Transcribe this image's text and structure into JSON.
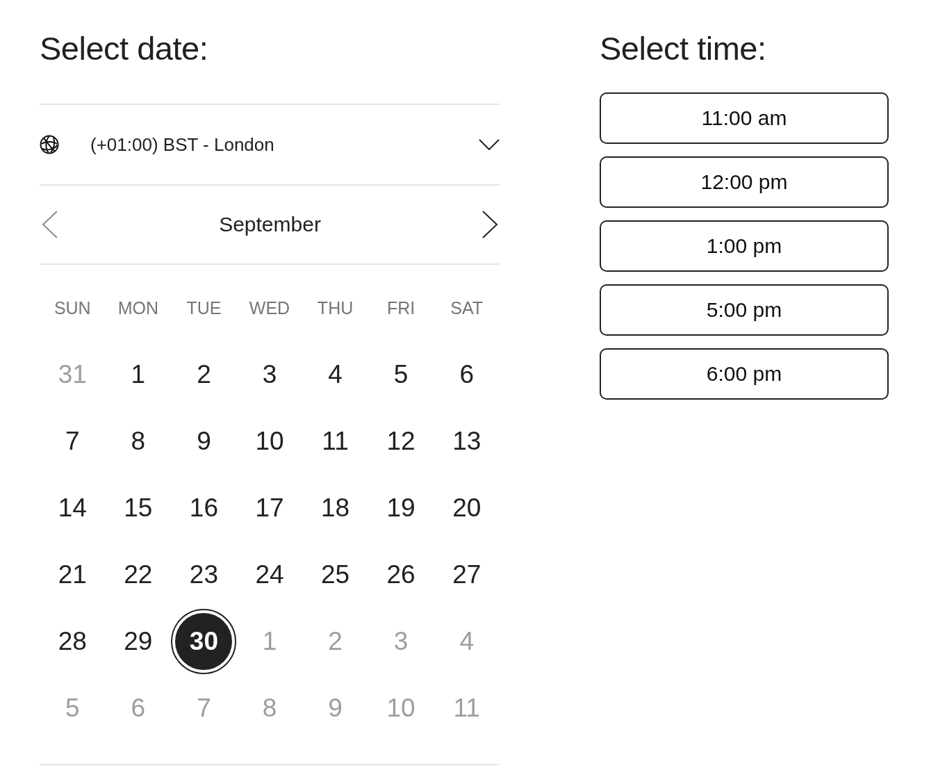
{
  "date_panel": {
    "title": "Select date:",
    "timezone": {
      "label": "(+01:00) BST - London"
    },
    "month_nav": {
      "month": "September",
      "prev": {
        "disabled": true
      },
      "next": {
        "disabled": false
      }
    },
    "weekdays": [
      "SUN",
      "MON",
      "TUE",
      "WED",
      "THU",
      "FRI",
      "SAT"
    ],
    "weeks": [
      {
        "days": [
          {
            "label": "31",
            "other_month": true,
            "selected": false
          },
          {
            "label": "1",
            "other_month": false,
            "selected": false
          },
          {
            "label": "2",
            "other_month": false,
            "selected": false
          },
          {
            "label": "3",
            "other_month": false,
            "selected": false
          },
          {
            "label": "4",
            "other_month": false,
            "selected": false
          },
          {
            "label": "5",
            "other_month": false,
            "selected": false
          },
          {
            "label": "6",
            "other_month": false,
            "selected": false
          }
        ]
      },
      {
        "days": [
          {
            "label": "7",
            "other_month": false,
            "selected": false
          },
          {
            "label": "8",
            "other_month": false,
            "selected": false
          },
          {
            "label": "9",
            "other_month": false,
            "selected": false
          },
          {
            "label": "10",
            "other_month": false,
            "selected": false
          },
          {
            "label": "11",
            "other_month": false,
            "selected": false
          },
          {
            "label": "12",
            "other_month": false,
            "selected": false
          },
          {
            "label": "13",
            "other_month": false,
            "selected": false
          }
        ]
      },
      {
        "days": [
          {
            "label": "14",
            "other_month": false,
            "selected": false
          },
          {
            "label": "15",
            "other_month": false,
            "selected": false
          },
          {
            "label": "16",
            "other_month": false,
            "selected": false
          },
          {
            "label": "17",
            "other_month": false,
            "selected": false
          },
          {
            "label": "18",
            "other_month": false,
            "selected": false
          },
          {
            "label": "19",
            "other_month": false,
            "selected": false
          },
          {
            "label": "20",
            "other_month": false,
            "selected": false
          }
        ]
      },
      {
        "days": [
          {
            "label": "21",
            "other_month": false,
            "selected": false
          },
          {
            "label": "22",
            "other_month": false,
            "selected": false
          },
          {
            "label": "23",
            "other_month": false,
            "selected": false
          },
          {
            "label": "24",
            "other_month": false,
            "selected": false
          },
          {
            "label": "25",
            "other_month": false,
            "selected": false
          },
          {
            "label": "26",
            "other_month": false,
            "selected": false
          },
          {
            "label": "27",
            "other_month": false,
            "selected": false
          }
        ]
      },
      {
        "days": [
          {
            "label": "28",
            "other_month": false,
            "selected": false
          },
          {
            "label": "29",
            "other_month": false,
            "selected": false
          },
          {
            "label": "30",
            "other_month": false,
            "selected": true
          },
          {
            "label": "1",
            "other_month": true,
            "selected": false
          },
          {
            "label": "2",
            "other_month": true,
            "selected": false
          },
          {
            "label": "3",
            "other_month": true,
            "selected": false
          },
          {
            "label": "4",
            "other_month": true,
            "selected": false
          }
        ]
      },
      {
        "days": [
          {
            "label": "5",
            "other_month": true,
            "selected": false
          },
          {
            "label": "6",
            "other_month": true,
            "selected": false
          },
          {
            "label": "7",
            "other_month": true,
            "selected": false
          },
          {
            "label": "8",
            "other_month": true,
            "selected": false
          },
          {
            "label": "9",
            "other_month": true,
            "selected": false
          },
          {
            "label": "10",
            "other_month": true,
            "selected": false
          },
          {
            "label": "11",
            "other_month": true,
            "selected": false
          }
        ]
      }
    ]
  },
  "time_panel": {
    "title": "Select time:",
    "slots": [
      {
        "label": "11:00 am",
        "selected": false
      },
      {
        "label": "12:00 pm",
        "selected": false
      },
      {
        "label": "1:00 pm",
        "selected": false
      },
      {
        "label": "5:00 pm",
        "selected": false
      },
      {
        "label": "6:00 pm",
        "selected": false
      }
    ]
  }
}
